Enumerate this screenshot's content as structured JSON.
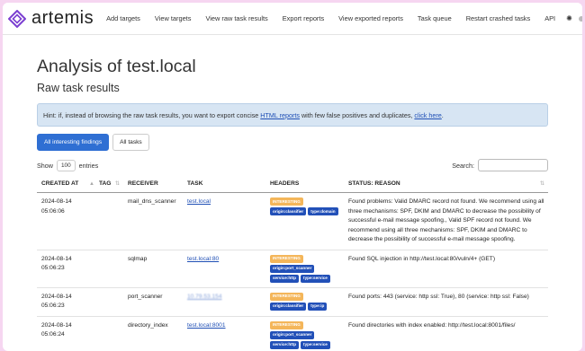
{
  "brand": {
    "name": "artemis"
  },
  "nav": {
    "items": [
      "Add targets",
      "View targets",
      "View raw task results",
      "Export reports",
      "View exported reports",
      "Task queue",
      "Restart crashed tasks",
      "API"
    ]
  },
  "page": {
    "title": "Analysis of test.local",
    "subtitle": "Raw task results"
  },
  "hint": {
    "prefix": "Hint: if, instead of browsing the raw task results, you want to export concise ",
    "link1": "HTML reports",
    "middle": " with few false positives and duplicates, ",
    "link2": "click here",
    "suffix": "."
  },
  "tabs": [
    {
      "label": "All interesting findings",
      "active": true
    },
    {
      "label": "All tasks",
      "active": false
    }
  ],
  "table_controls": {
    "show_label": "Show",
    "entries_value": "100",
    "entries_label": "entries",
    "search_label": "Search:"
  },
  "columns": [
    "CREATED AT",
    "TAG",
    "RECEIVER",
    "TASK",
    "HEADERS",
    "STATUS: REASON"
  ],
  "rows": [
    {
      "created": "2024-08-14 05:06:06",
      "tag": "",
      "receiver": "mail_dns_scanner",
      "task": "test.local",
      "task_blurred": false,
      "headers": [
        "INTERESTING",
        "origin:classifier",
        "type:domain"
      ],
      "status": "Found problems: Valid DMARC record not found. We recommend using all three mechanisms: SPF, DKIM and DMARC to decrease the possibility of successful e-mail message spoofing., Valid SPF record not found. We recommend using all three mechanisms: SPF, DKIM and DMARC to decrease the possibility of successful e-mail message spoofing."
    },
    {
      "created": "2024-08-14 05:06:23",
      "tag": "",
      "receiver": "sqlmap",
      "task": "test.local:80",
      "task_blurred": false,
      "headers": [
        "INTERESTING",
        "origin:port_scanner",
        "service:http",
        "type:service"
      ],
      "status": "Found SQL injection in http://test.local:80/vuln/4+ (GET)"
    },
    {
      "created": "2024-08-14 05:06:23",
      "tag": "",
      "receiver": "port_scanner",
      "task": "10.79.53.154",
      "task_blurred": true,
      "headers": [
        "INTERESTING",
        "origin:classifier",
        "type:ip"
      ],
      "status": "Found ports: 443 (service: http ssl: True), 80 (service: http ssl: False)"
    },
    {
      "created": "2024-08-14 05:06:24",
      "tag": "",
      "receiver": "directory_index",
      "task": "test.local:8001",
      "task_blurred": false,
      "headers": [
        "INTERESTING",
        "origin:port_scanner",
        "service:http",
        "type:service"
      ],
      "status": "Found directories with index enabled: http://test.local:8001/files/"
    }
  ],
  "colors": {
    "accent": "#2f6fd3",
    "interesting_badge": "#f4b65a",
    "tag_badge": "#2250b8",
    "hint_bg": "#d7e5f3",
    "frame_bg": "#f6d6f1"
  }
}
